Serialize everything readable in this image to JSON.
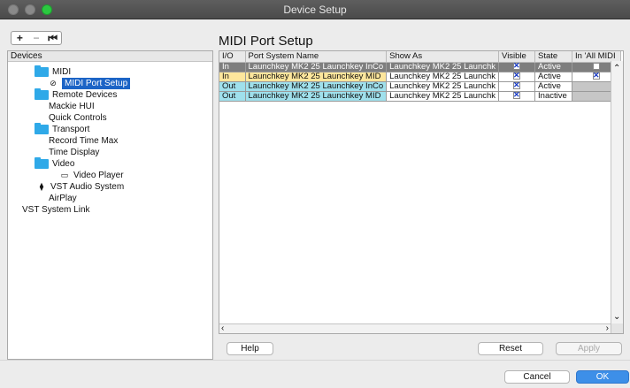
{
  "window": {
    "title": "Device Setup"
  },
  "toolbar": {
    "add_label": "+",
    "remove_label": "−",
    "reset_label": "⏮"
  },
  "devices": {
    "header": "Devices",
    "items": [
      {
        "label": "MIDI",
        "icon": "folder-icon"
      },
      {
        "label": "MIDI Port Setup",
        "icon": "midi-port-icon",
        "selected": true
      },
      {
        "label": "Remote Devices",
        "icon": "folder-icon"
      },
      {
        "label": "Mackie HUI",
        "icon": ""
      },
      {
        "label": "Quick Controls",
        "icon": ""
      },
      {
        "label": "Transport",
        "icon": "folder-icon"
      },
      {
        "label": "Record Time Max",
        "icon": ""
      },
      {
        "label": "Time Display",
        "icon": ""
      },
      {
        "label": "Video",
        "icon": "folder-icon"
      },
      {
        "label": "Video Player",
        "icon": "video-player-icon"
      },
      {
        "label": "VST Audio System",
        "icon": "audio-system-icon"
      },
      {
        "label": "AirPlay",
        "icon": ""
      },
      {
        "label": "VST System Link",
        "icon": ""
      }
    ]
  },
  "midi_port_setup": {
    "title": "MIDI Port Setup",
    "columns": [
      "I/O",
      "Port System Name",
      "Show As",
      "Visible",
      "State",
      "In 'All MIDI"
    ],
    "rows": [
      {
        "io": "In",
        "port": "Launchkey MK2 25 Launchkey InCo",
        "show_as": "Launchkey MK2 25 Launchk",
        "visible": true,
        "state": "Active",
        "all_midi": false,
        "selected": true
      },
      {
        "io": "In",
        "port": "Launchkey MK2 25 Launchkey MID",
        "show_as": "Launchkey MK2 25 Launchk",
        "visible": true,
        "state": "Active",
        "all_midi": true,
        "selected": false
      },
      {
        "io": "Out",
        "port": "Launchkey MK2 25 Launchkey InCo",
        "show_as": "Launchkey MK2 25 Launchk",
        "visible": true,
        "state": "Active",
        "all_midi": null,
        "selected": false
      },
      {
        "io": "Out",
        "port": "Launchkey MK2 25 Launchkey MID",
        "show_as": "Launchkey MK2 25 Launchk",
        "visible": true,
        "state": "Inactive",
        "all_midi": null,
        "selected": false
      }
    ]
  },
  "buttons": {
    "help": "Help",
    "reset": "Reset",
    "apply": "Apply",
    "cancel": "Cancel",
    "ok": "OK"
  },
  "colors": {
    "in_row": "#fde69c",
    "out_row": "#9fe0ec",
    "selection": "#1c64c6",
    "ok_button": "#3d8fe8"
  }
}
